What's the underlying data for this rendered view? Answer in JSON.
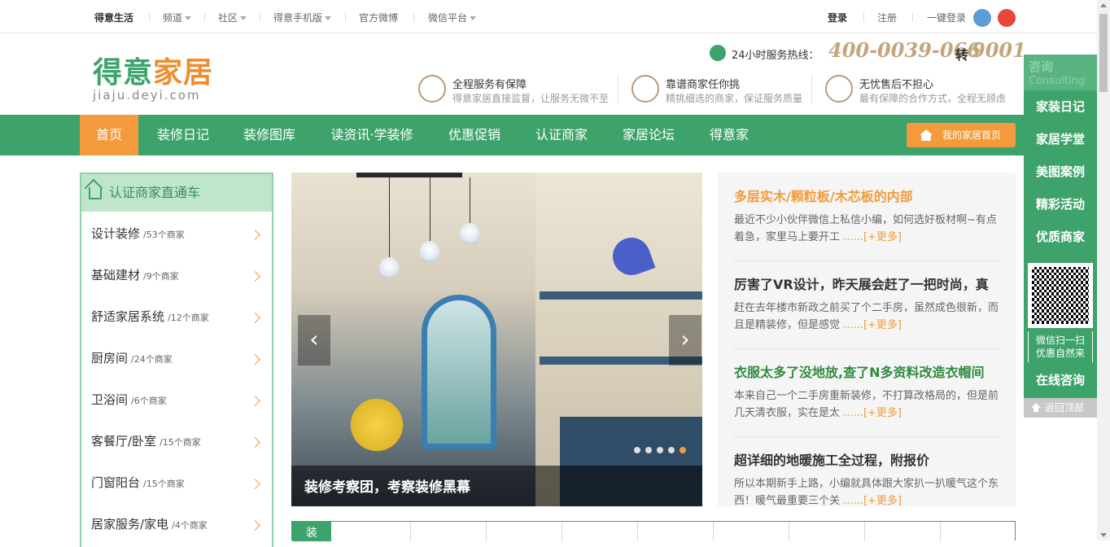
{
  "topbar": {
    "brand": "得意生活",
    "menu": [
      "频道",
      "社区",
      "得意手机版",
      "官方微博",
      "微信平台"
    ],
    "login": "登录",
    "register": "注册",
    "one_click": "一键登录",
    "icons": [
      "qq-icon",
      "weibo-icon"
    ]
  },
  "header": {
    "logo_cn_a": "得意",
    "logo_cn_b": "家居",
    "logo_en": "jiaju.deyi.com",
    "hotline_label": "24小时服务热线：",
    "hotline_number": "400-0039-066",
    "hotline_ext_label": "转",
    "hotline_ext": "9001",
    "features": [
      {
        "title": "全程服务有保障",
        "desc": "得意家居直接监督，让服务无微不至"
      },
      {
        "title": "靠谱商家任你挑",
        "desc": "精挑细选的商家，保证服务质量"
      },
      {
        "title": "无忧售后不担心",
        "desc": "最有保障的合作方式，全程无顾虑"
      }
    ]
  },
  "nav": {
    "items": [
      "首页",
      "装修日记",
      "装修图库",
      "读资讯·学装修",
      "优惠促销",
      "认证商家",
      "家居论坛",
      "得意家"
    ],
    "active": "首页",
    "my_home": "我的家居首页"
  },
  "sidebar": {
    "title": "认证商家直通车",
    "categories": [
      {
        "name": "设计装修",
        "count": "/53个商家"
      },
      {
        "name": "基础建材",
        "count": "/9个商家"
      },
      {
        "name": "舒适家居系统",
        "count": "/12个商家"
      },
      {
        "name": "厨房间",
        "count": "/24个商家"
      },
      {
        "name": "卫浴间",
        "count": "/6个商家"
      },
      {
        "name": "客餐厅/卧室",
        "count": "/15个商家"
      },
      {
        "name": "门窗阳台",
        "count": "/15个商家"
      },
      {
        "name": "居家服务/家电",
        "count": "/4个商家"
      }
    ]
  },
  "slider": {
    "caption": "装修考察团，考察装修黑幕",
    "prev": "‹",
    "next": "›",
    "dot_count": 5,
    "active_dot": 5,
    "colors": {
      "dot": "#dddddd",
      "active_dot": "#f39a3c"
    }
  },
  "news": [
    {
      "title": "多层实木/颗粒板/木芯板的内部",
      "desc": "最近不少小伙伴微信上私信小编，如何选好板材啊~有点着急，家里马上要开工",
      "more": "......[+更多]",
      "title_color": "#f39a3c"
    },
    {
      "title": "厉害了VR设计，昨天展会赶了一把时尚，真",
      "desc": "赶在去年楼市新政之前买了个二手房，虽然成色很新，而且是精装修，但是感觉",
      "more": "......[+更多]",
      "title_color": "#333333"
    },
    {
      "title": "衣服太多了没地放,查了N多资料改造衣帽间",
      "desc": "本来自己一个二手房重新装修，不打算改格局的，但是前几天清衣服，实在是太",
      "more": "......[+更多]",
      "title_color": "#2e8b3e"
    },
    {
      "title": "超详细的地暖施工全过程，附报价",
      "desc": "所以本期新手上路，小编就具体跟大家扒一扒暖气这个东西！暖气最重要三个关",
      "more": "......[+更多]",
      "title_color": "#333333"
    }
  ],
  "bottom": {
    "tag": "装"
  },
  "rightbar": {
    "consult_cn": "咨询",
    "consult_en": "Consulting",
    "links": [
      "家装日记",
      "家居学堂",
      "美图案例",
      "精彩活动",
      "优质商家"
    ],
    "scan_line1": "微信扫一扫",
    "scan_line2": "优惠自然来",
    "online": "在线咨询",
    "back_top": "返回顶部"
  },
  "colors": {
    "brand_green": "#3ea36b",
    "accent_orange": "#f39a3c"
  }
}
